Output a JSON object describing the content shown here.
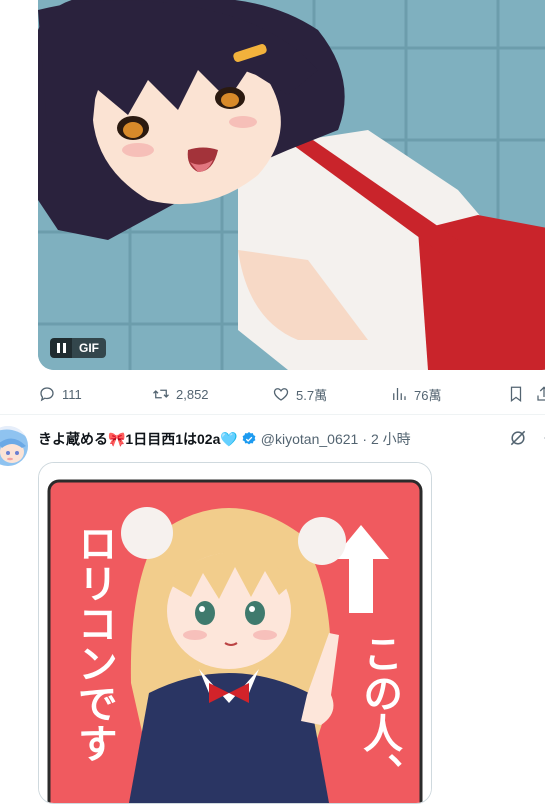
{
  "tweet1": {
    "media": {
      "badge": "GIF"
    },
    "actions": {
      "replies": "111",
      "retweets": "2,852",
      "likes": "5.7萬",
      "views": "76萬"
    }
  },
  "tweet2": {
    "display_name": "きよ蔵める🎀1日目西1は02a🩵",
    "handle": "@kiyotan_0621",
    "separator": "·",
    "time": "2 小時",
    "media": {
      "vertical_text_left": "ロリコンです",
      "vertical_text_right": "この人、"
    }
  },
  "colors": {
    "accent": "#1d9bf0",
    "muted": "#536471",
    "sign_red": "#f05a5f"
  }
}
